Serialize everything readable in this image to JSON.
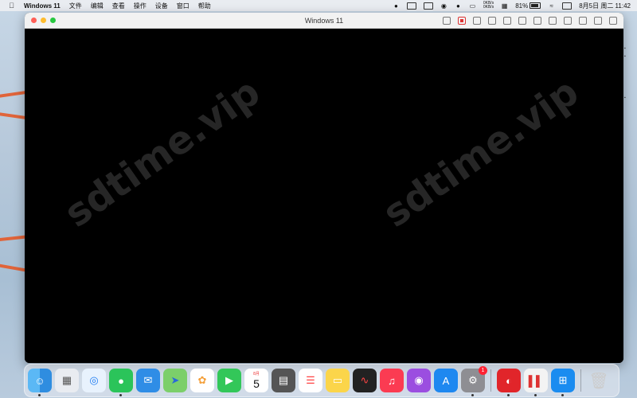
{
  "menubar": {
    "app_name": "Windows 11",
    "menus": [
      "文件",
      "编辑",
      "查看",
      "操作",
      "设备",
      "窗口",
      "帮助"
    ],
    "net_up": "0KB/s",
    "net_down": "0KB/s",
    "battery": "81%",
    "clock": "8月5日 周二  11:42"
  },
  "window": {
    "title": "Windows 11",
    "watermark": "sdtime.vip"
  },
  "dock": {
    "calendar_month": "8月",
    "calendar_day": "5",
    "settings_badge": "1"
  },
  "colors": {
    "accent_red": "#ff5f57",
    "accent_yellow": "#febc2e",
    "accent_green": "#28c840"
  }
}
